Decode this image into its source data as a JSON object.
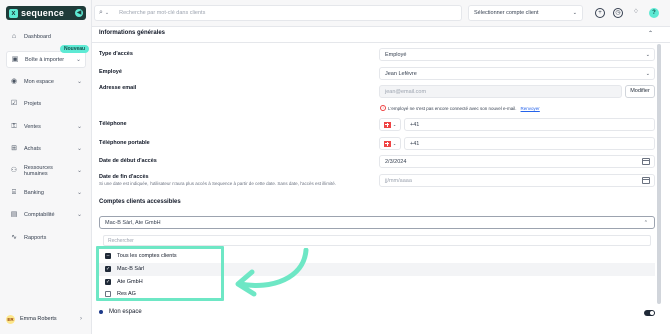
{
  "brand": {
    "name": "sequence",
    "mark": "x",
    "toggle": "◀"
  },
  "sidebar": {
    "new_badge": "Nouveau",
    "items": [
      {
        "label": "Dashboard",
        "icon": "home-icon",
        "glyph": "⌂",
        "chev": ""
      },
      {
        "label": "Boîte à importer",
        "icon": "inbox-icon",
        "glyph": "▣",
        "chev": "⌄"
      },
      {
        "label": "Mon espace",
        "icon": "user-space-icon",
        "glyph": "◉",
        "chev": "⌄"
      },
      {
        "label": "Projets",
        "icon": "projects-icon",
        "glyph": "☑",
        "chev": ""
      },
      {
        "label": "Ventes",
        "icon": "sales-icon",
        "glyph": "⚿",
        "chev": "⌄"
      },
      {
        "label": "Achats",
        "icon": "purchases-icon",
        "glyph": "⊞",
        "chev": "⌄"
      },
      {
        "label": "Ressources humaines",
        "icon": "hr-icon",
        "glyph": "⚇",
        "chev": "⌄"
      },
      {
        "label": "Banking",
        "icon": "bank-icon",
        "glyph": "⌸",
        "chev": "⌄"
      },
      {
        "label": "Comptabilité",
        "icon": "accounting-icon",
        "glyph": "▤",
        "chev": "⌄"
      },
      {
        "label": "Rapports",
        "icon": "reports-icon",
        "glyph": "∿",
        "chev": ""
      }
    ],
    "user": {
      "initials": "ER",
      "name": "Emma Roberts",
      "chev": "›"
    }
  },
  "topbar": {
    "search_icon": "⌕",
    "search_chev": "⌄",
    "search_placeholder": "Recherche par mot-clé dans clients",
    "account_placeholder": "Sélectionner compte client",
    "account_chev": "⌄",
    "icons": [
      "+",
      "◷",
      "♢"
    ],
    "help": "?"
  },
  "form": {
    "section_title": "Informations générales",
    "section_chev": "⌃",
    "access_type_label": "Type d'accès",
    "access_type_value": "Employé",
    "employee_label": "Employé",
    "employee_value": "Jean Lefèvre",
    "email_label": "Adresse email",
    "email_value": "jean@email.com",
    "modify_button": "Modifier",
    "warning_icon": "!",
    "warning_text": "L'employé ne s'est pas encore connecté avec son nouvel e-mail.",
    "resend_link": "Renvoyer",
    "phone_label": "Téléphone",
    "phone_value": "+41",
    "mobile_label": "Téléphone portable",
    "mobile_value": "+41",
    "phone_chev": "⌄",
    "start_label": "Date de début d'accès",
    "start_value": "2/3/2024",
    "end_label": "Date de fin d'accès",
    "end_help": "Si une date est indiquée, l'utilisateur n'aura plus accès à Sequence à partir de cette date. Sans date, l'accès est illimité.",
    "end_placeholder": "jj/mm/aaaa",
    "dropdown_chev": "⌄"
  },
  "accounts": {
    "title": "Comptes clients accessibles",
    "selected": "Mac-B Sàrl, Ate GmbH",
    "chev": "⌃",
    "search_placeholder": "Rechercher",
    "options": [
      {
        "label": "Tous les comptes clients",
        "state": "indeterminate",
        "mark": "–"
      },
      {
        "label": "Mac-B Sàrl",
        "state": "checked",
        "mark": "✓"
      },
      {
        "label": "Ate GmbH",
        "state": "checked",
        "mark": "✓"
      },
      {
        "label": "Res AG",
        "state": "unchecked",
        "mark": ""
      }
    ]
  },
  "mon_espace": {
    "label": "Mon espace"
  },
  "colors": {
    "brand_dark": "#1f3b39",
    "accent": "#5eead4",
    "highlight": "#6ee7c5"
  }
}
